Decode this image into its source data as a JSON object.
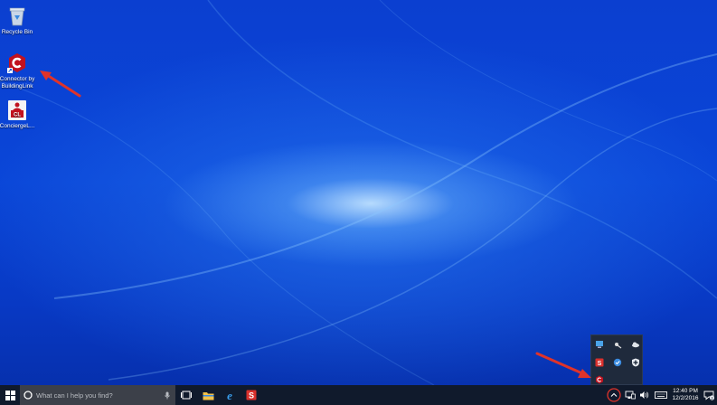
{
  "desktop": {
    "icons": [
      {
        "label": "Recycle Bin",
        "icon": "recycle-bin-icon"
      },
      {
        "label": "Connector by BuildingLink",
        "label_line1": "Connector by",
        "label_line2": "BuildingLink",
        "icon": "connector-app-icon"
      },
      {
        "label": "ConciergeL...",
        "icon": "conciergelink-app-icon",
        "badge": "CL"
      }
    ]
  },
  "taskbar": {
    "search_placeholder": "What can I help you find?",
    "pinned": [
      "task-view-icon",
      "file-explorer-icon",
      "edge-icon",
      "snagit-icon"
    ],
    "tray": {
      "overflow_icons": [
        "display-icon",
        "network-tool-icon",
        "onedrive-icon",
        "snagit-icon",
        "sync-check-icon",
        "security-shield-icon",
        "connector-app-icon"
      ],
      "time": "12:40 PM",
      "date": "12/2/2016",
      "notification_count": "2"
    }
  },
  "annotations": {
    "arrow_color": "#e0332a"
  }
}
